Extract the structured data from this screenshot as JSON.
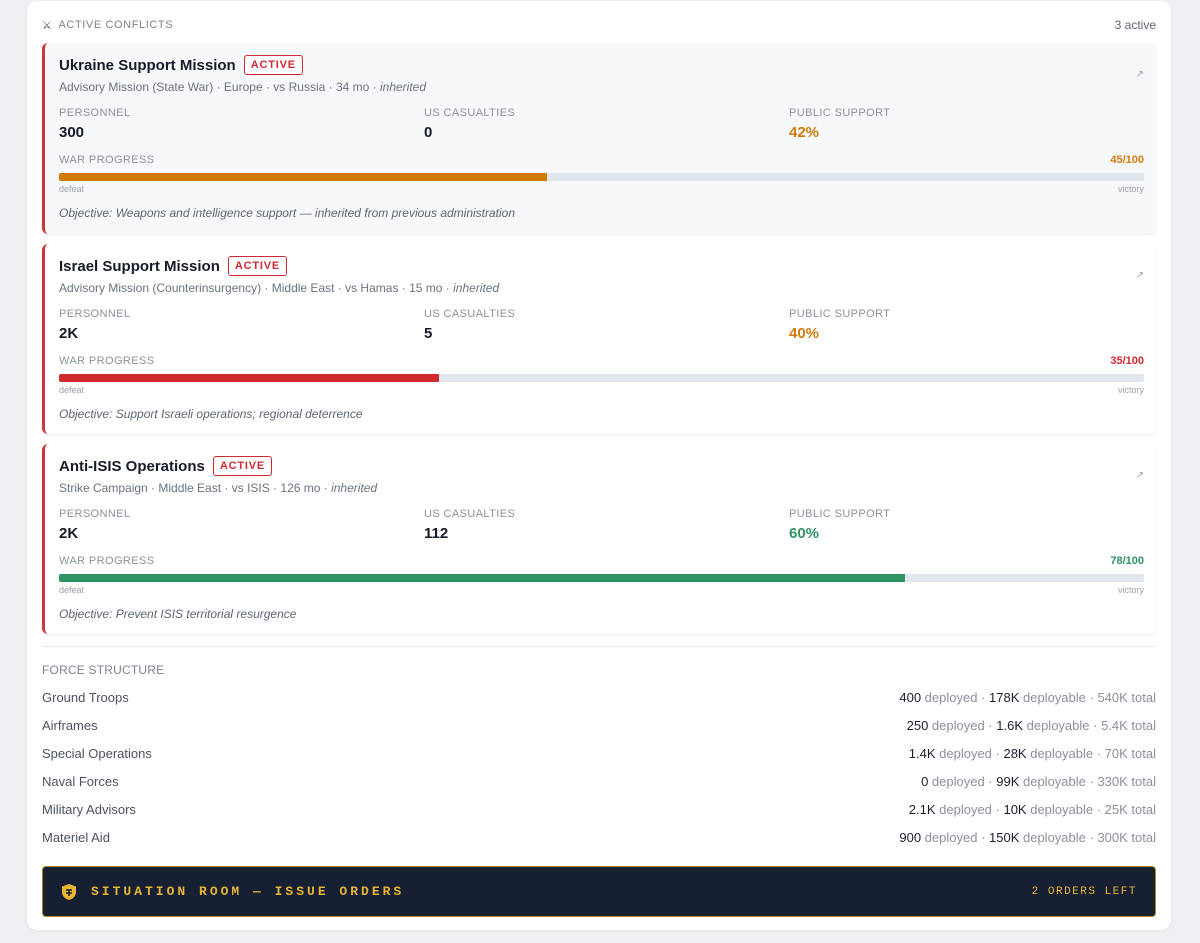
{
  "header": {
    "icon": "crossed-swords-icon",
    "title": "ACTIVE CONFLICTS",
    "active_count": "3 active"
  },
  "labels": {
    "personnel": "PERSONNEL",
    "casualties": "US CASUALTIES",
    "support": "PUBLIC SUPPORT",
    "war_progress": "WAR PROGRESS",
    "defeat": "defeat",
    "victory": "victory"
  },
  "conflicts": [
    {
      "name": "Ukraine Support Mission",
      "status": "ACTIVE",
      "subtitle": "Advisory Mission (State War) · Europe · vs Russia · 34 mo · ",
      "inherited": "inherited",
      "personnel": "300",
      "casualties": "0",
      "support": "42%",
      "support_color": "#d17a0a",
      "progress_text": "45/100",
      "progress": 45,
      "progress_color": "#d17a0a",
      "objective": "Objective: Weapons and intelligence support — inherited from previous administration"
    },
    {
      "name": "Israel Support Mission",
      "status": "ACTIVE",
      "subtitle": "Advisory Mission (Counterinsurgency) · Middle East · vs Hamas · 15 mo · ",
      "inherited": "inherited",
      "personnel": "2K",
      "casualties": "5",
      "support": "40%",
      "support_color": "#d17a0a",
      "progress_text": "35/100",
      "progress": 35,
      "progress_color": "#d02a2f",
      "objective": "Objective: Support Israeli operations; regional deterrence"
    },
    {
      "name": "Anti-ISIS Operations",
      "status": "ACTIVE",
      "subtitle": "Strike Campaign · Middle East · vs ISIS · 126 mo · ",
      "inherited": "inherited",
      "personnel": "2K",
      "casualties": "112",
      "support": "60%",
      "support_color": "#2f9462",
      "progress_text": "78/100",
      "progress": 78,
      "progress_color": "#2f9462",
      "objective": "Objective: Prevent ISIS territorial resurgence"
    }
  ],
  "force_structure": {
    "title": "FORCE STRUCTURE",
    "deployed_label": " deployed · ",
    "deployable_label": " deployable · ",
    "total_label": " total",
    "rows": [
      {
        "name": "Ground Troops",
        "deployed": "400",
        "deployable": "178K",
        "total": "540K"
      },
      {
        "name": "Airframes",
        "deployed": "250",
        "deployable": "1.6K",
        "total": "5.4K"
      },
      {
        "name": "Special Operations",
        "deployed": "1.4K",
        "deployable": "28K",
        "total": "70K"
      },
      {
        "name": "Naval Forces",
        "deployed": "0",
        "deployable": "99K",
        "total": "330K"
      },
      {
        "name": "Military Advisors",
        "deployed": "2.1K",
        "deployable": "10K",
        "total": "25K"
      },
      {
        "name": "Materiel Aid",
        "deployed": "900",
        "deployable": "150K",
        "total": "300K"
      }
    ]
  },
  "situation_room": {
    "icon": "shield-icon",
    "label": "SITUATION ROOM — ISSUE ORDERS",
    "orders_left": "2 ORDERS LEFT"
  }
}
